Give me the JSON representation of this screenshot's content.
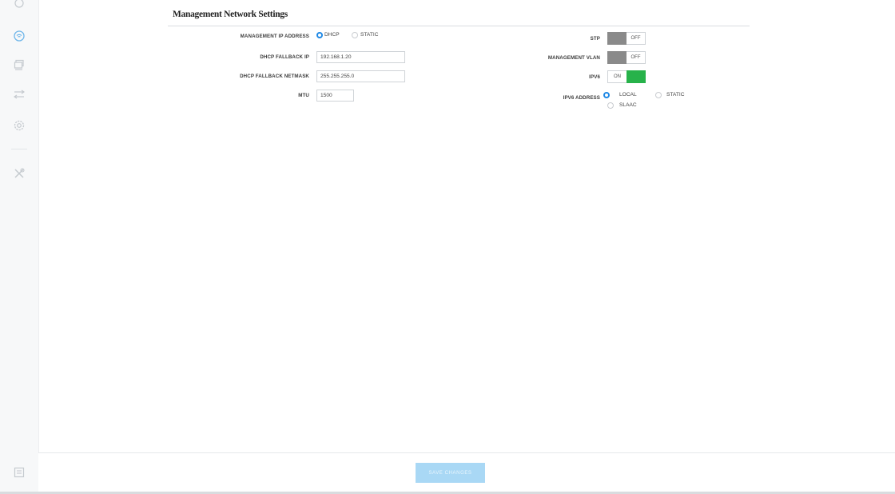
{
  "section_title": "Management Network Settings",
  "left": {
    "mgmt_ip_label": "MANAGEMENT IP ADDRESS",
    "dhcp_option": "DHCP",
    "static_option": "STATIC",
    "dhcp_fallback_ip_label": "DHCP FALLBACK IP",
    "dhcp_fallback_ip_value": "192.168.1.20",
    "dhcp_fallback_netmask_label": "DHCP FALLBACK NETMASK",
    "dhcp_fallback_netmask_value": "255.255.255.0",
    "mtu_label": "MTU",
    "mtu_value": "1500"
  },
  "right": {
    "stp_label": "STP",
    "stp_state": "OFF",
    "mgmt_vlan_label": "MANAGEMENT VLAN",
    "mgmt_vlan_state": "OFF",
    "ipv6_label": "IPV6",
    "ipv6_state": "ON",
    "ipv6_address_label": "IPV6 ADDRESS",
    "local_option": "LOCAL",
    "static_option": "STATIC",
    "slaac_option": "SLAAC"
  },
  "selected": {
    "management_ip": "DHCP",
    "ipv6_address": "LOCAL"
  },
  "footer": {
    "save_label": "SAVE CHANGES"
  },
  "colors": {
    "accent": "#1e88e5",
    "toggle_on": "#27b24a",
    "toggle_off": "#8a8a8a",
    "save_disabled": "#a9d8f5"
  },
  "sidebar_icons": [
    "dashboard-icon",
    "wireless-icon",
    "device-icon",
    "network-icon",
    "settings-icon",
    "tools-icon",
    "news-icon"
  ]
}
